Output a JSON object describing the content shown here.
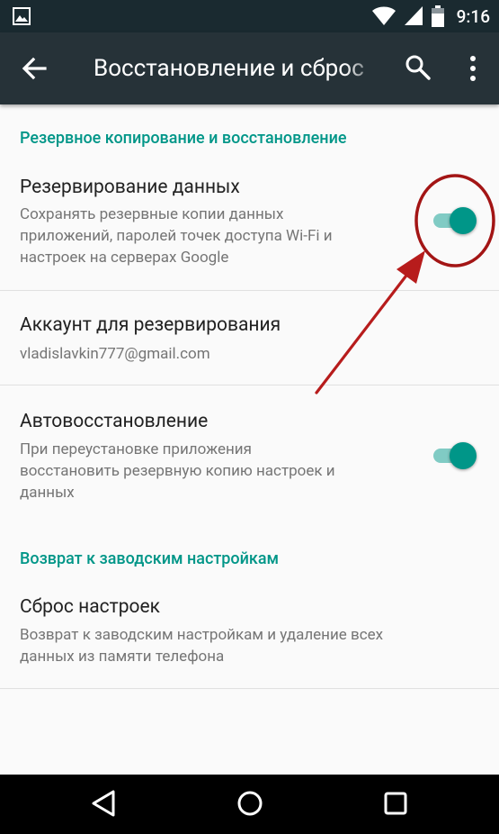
{
  "status_bar": {
    "time": "9:16",
    "icons": [
      "gallery-icon",
      "wifi-icon",
      "signal-icon",
      "battery-icon"
    ]
  },
  "toolbar": {
    "title": "Восстановление и сброс",
    "icons": [
      "back-arrow-icon",
      "search-icon",
      "more-vert-icon"
    ]
  },
  "sections": {
    "backup": {
      "header": "Резервное копирование и восстановление",
      "items": [
        {
          "title": "Резервирование данных",
          "summary_lines": [
            "Сохранять резервные копии данных",
            "приложений, паролей точек доступа Wi-Fi и",
            "настроек на серверах Google"
          ],
          "toggle": "on"
        },
        {
          "title": "Аккаунт для резервирования",
          "summary": "vladislavkin777@gmail.com"
        },
        {
          "title": "Автовосстановление",
          "summary_lines": [
            "При переустановке приложения",
            "восстановить резервную копию настроек и",
            "данных"
          ],
          "toggle": "on"
        }
      ]
    },
    "reset": {
      "header": "Возврат к заводским настройкам",
      "items": [
        {
          "title": "Сброс настроек",
          "summary_lines": [
            "Возврат к заводским настройкам и удаление всех",
            "данных из памяти телефона"
          ]
        }
      ]
    }
  },
  "colors": {
    "accent": "#009688",
    "accent_light": "#80cbc4",
    "toolbar": "#263238",
    "status_bar": "#1a2a30",
    "annotation": "#b71c1c"
  },
  "nav_bar": {
    "icons": [
      "back-triangle-icon",
      "home-circle-icon",
      "recents-square-icon"
    ]
  }
}
